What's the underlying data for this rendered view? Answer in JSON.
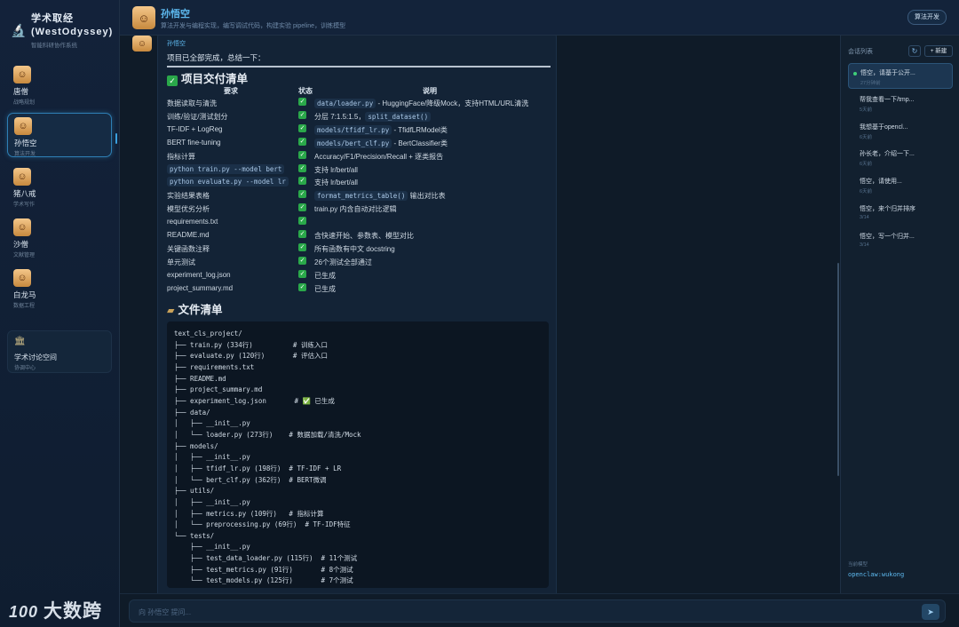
{
  "app": {
    "title": "学术取经\n(WestOdyssey)",
    "subtitle": "智能科研协作系统"
  },
  "agents": [
    {
      "name": "唐僧",
      "role": "战略规划"
    },
    {
      "name": "孙悟空",
      "role": "算法开发"
    },
    {
      "name": "猪八戒",
      "role": "学术写作"
    },
    {
      "name": "沙僧",
      "role": "文献管理"
    },
    {
      "name": "白龙马",
      "role": "数据工程"
    }
  ],
  "space": {
    "title": "学术讨论空间",
    "subtitle": "协调中心"
  },
  "watermark": "大数跨境",
  "header": {
    "name": "孙悟空",
    "description": "算法开发与编程实现，编写调试代码，构建实验 pipeline，训练模型",
    "badge": "算法开发"
  },
  "message": {
    "sender": "孙悟空",
    "intro": "项目已全部完成，总结一下：",
    "deliverables_title": "项目交付清单",
    "files_title": "文件清单",
    "table": {
      "headers": [
        "要求",
        "状态",
        "说明"
      ],
      "rows": [
        {
          "req": "数据读取与清洗",
          "note_code": "data/loader.py",
          "note": " - HuggingFace/降级Mock，支持HTML/URL清洗"
        },
        {
          "req": "训练/验证/测试划分",
          "note_pre": "分层 7:1.5:1.5，",
          "note_code": "split_dataset()",
          "note": ""
        },
        {
          "req": "TF-IDF + LogReg",
          "note_code": "models/tfidf_lr.py",
          "note": " - TfidfLRModel类"
        },
        {
          "req": "BERT fine-tuning",
          "note_code": "models/bert_clf.py",
          "note": " - BertClassifier类"
        },
        {
          "req": "指标计算",
          "note": "Accuracy/F1/Precision/Recall + 逐类报告"
        },
        {
          "req_code": "python train.py --model bert",
          "note": "支持 lr/bert/all"
        },
        {
          "req_code": "python evaluate.py --model lr",
          "note": "支持 lr/bert/all"
        },
        {
          "req": "实验结果表格",
          "note_code": "format_metrics_table()",
          "note": " 输出对比表"
        },
        {
          "req": "模型优劣分析",
          "note": "train.py 内含自动对比逻辑"
        },
        {
          "req": "requirements.txt",
          "note": ""
        },
        {
          "req": "README.md",
          "note": "含快速开始、参数表、模型对比"
        },
        {
          "req": "关键函数注释",
          "note": "所有函数有中文 docstring"
        },
        {
          "req": "单元测试",
          "note": "26个测试全部通过"
        },
        {
          "req": "experiment_log.json",
          "note": "已生成"
        },
        {
          "req": "project_summary.md",
          "note": "已生成"
        }
      ]
    },
    "tree": [
      "text_cls_project/",
      "├── train.py (334行)          # 训练入口",
      "├── evaluate.py (120行)       # 评估入口",
      "├── requirements.txt",
      "├── README.md",
      "├── project_summary.md",
      "├── experiment_log.json       # ✅ 已生成",
      "├── data/",
      "│   ├── __init__.py",
      "│   └── loader.py (273行)    # 数据加载/清洗/Mock",
      "├── models/",
      "│   ├── __init__.py",
      "│   ├── tfidf_lr.py (198行)  # TF-IDF + LR",
      "│   └── bert_clf.py (362行)  # BERT微调",
      "├── utils/",
      "│   ├── __init__.py",
      "│   ├── metrics.py (109行)   # 指标计算",
      "│   └── preprocessing.py (69行)  # TF-IDF特征",
      "└── tests/",
      "    ├── __init__.py",
      "    ├── test_data_loader.py (115行)  # 11个测试",
      "    ├── test_metrics.py (91行)       # 8个测试",
      "    └── test_models.py (125行)       # 7个测试"
    ]
  },
  "sessions_panel": {
    "title": "会话列表",
    "new_label": "+ 新建",
    "sessions": [
      {
        "title": "悟空，请基于公开...",
        "time": "27分钟前"
      },
      {
        "title": "帮我查看一下/tmp...",
        "time": "5天前"
      },
      {
        "title": "我想基于opencl...",
        "time": "6天前"
      },
      {
        "title": "孙长老，介绍一下...",
        "time": "6天前"
      },
      {
        "title": "悟空，请使用...",
        "time": "6天前"
      },
      {
        "title": "悟空，来个归并排序",
        "time": "3/14"
      },
      {
        "title": "悟空，写一个归并...",
        "time": "3/14"
      }
    ],
    "model_label": "当前模型",
    "model_value": "openclaw:wukong"
  },
  "input": {
    "placeholder": "向 孙悟空 提问..."
  },
  "colors": {
    "accent": "#5db8ee",
    "check": "#2aa84a",
    "bg": "#0f1b28"
  }
}
